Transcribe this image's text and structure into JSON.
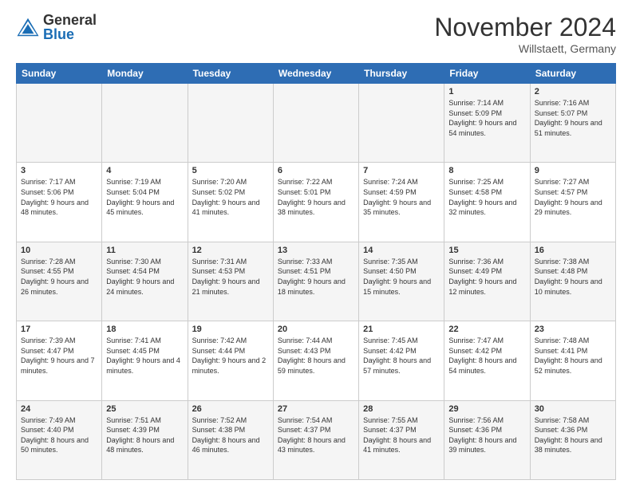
{
  "logo": {
    "general": "General",
    "blue": "Blue"
  },
  "header": {
    "month": "November 2024",
    "location": "Willstaett, Germany"
  },
  "weekdays": [
    "Sunday",
    "Monday",
    "Tuesday",
    "Wednesday",
    "Thursday",
    "Friday",
    "Saturday"
  ],
  "weeks": [
    [
      {
        "day": "",
        "info": ""
      },
      {
        "day": "",
        "info": ""
      },
      {
        "day": "",
        "info": ""
      },
      {
        "day": "",
        "info": ""
      },
      {
        "day": "",
        "info": ""
      },
      {
        "day": "1",
        "info": "Sunrise: 7:14 AM\nSunset: 5:09 PM\nDaylight: 9 hours and 54 minutes."
      },
      {
        "day": "2",
        "info": "Sunrise: 7:16 AM\nSunset: 5:07 PM\nDaylight: 9 hours and 51 minutes."
      }
    ],
    [
      {
        "day": "3",
        "info": "Sunrise: 7:17 AM\nSunset: 5:06 PM\nDaylight: 9 hours and 48 minutes."
      },
      {
        "day": "4",
        "info": "Sunrise: 7:19 AM\nSunset: 5:04 PM\nDaylight: 9 hours and 45 minutes."
      },
      {
        "day": "5",
        "info": "Sunrise: 7:20 AM\nSunset: 5:02 PM\nDaylight: 9 hours and 41 minutes."
      },
      {
        "day": "6",
        "info": "Sunrise: 7:22 AM\nSunset: 5:01 PM\nDaylight: 9 hours and 38 minutes."
      },
      {
        "day": "7",
        "info": "Sunrise: 7:24 AM\nSunset: 4:59 PM\nDaylight: 9 hours and 35 minutes."
      },
      {
        "day": "8",
        "info": "Sunrise: 7:25 AM\nSunset: 4:58 PM\nDaylight: 9 hours and 32 minutes."
      },
      {
        "day": "9",
        "info": "Sunrise: 7:27 AM\nSunset: 4:57 PM\nDaylight: 9 hours and 29 minutes."
      }
    ],
    [
      {
        "day": "10",
        "info": "Sunrise: 7:28 AM\nSunset: 4:55 PM\nDaylight: 9 hours and 26 minutes."
      },
      {
        "day": "11",
        "info": "Sunrise: 7:30 AM\nSunset: 4:54 PM\nDaylight: 9 hours and 24 minutes."
      },
      {
        "day": "12",
        "info": "Sunrise: 7:31 AM\nSunset: 4:53 PM\nDaylight: 9 hours and 21 minutes."
      },
      {
        "day": "13",
        "info": "Sunrise: 7:33 AM\nSunset: 4:51 PM\nDaylight: 9 hours and 18 minutes."
      },
      {
        "day": "14",
        "info": "Sunrise: 7:35 AM\nSunset: 4:50 PM\nDaylight: 9 hours and 15 minutes."
      },
      {
        "day": "15",
        "info": "Sunrise: 7:36 AM\nSunset: 4:49 PM\nDaylight: 9 hours and 12 minutes."
      },
      {
        "day": "16",
        "info": "Sunrise: 7:38 AM\nSunset: 4:48 PM\nDaylight: 9 hours and 10 minutes."
      }
    ],
    [
      {
        "day": "17",
        "info": "Sunrise: 7:39 AM\nSunset: 4:47 PM\nDaylight: 9 hours and 7 minutes."
      },
      {
        "day": "18",
        "info": "Sunrise: 7:41 AM\nSunset: 4:45 PM\nDaylight: 9 hours and 4 minutes."
      },
      {
        "day": "19",
        "info": "Sunrise: 7:42 AM\nSunset: 4:44 PM\nDaylight: 9 hours and 2 minutes."
      },
      {
        "day": "20",
        "info": "Sunrise: 7:44 AM\nSunset: 4:43 PM\nDaylight: 8 hours and 59 minutes."
      },
      {
        "day": "21",
        "info": "Sunrise: 7:45 AM\nSunset: 4:42 PM\nDaylight: 8 hours and 57 minutes."
      },
      {
        "day": "22",
        "info": "Sunrise: 7:47 AM\nSunset: 4:42 PM\nDaylight: 8 hours and 54 minutes."
      },
      {
        "day": "23",
        "info": "Sunrise: 7:48 AM\nSunset: 4:41 PM\nDaylight: 8 hours and 52 minutes."
      }
    ],
    [
      {
        "day": "24",
        "info": "Sunrise: 7:49 AM\nSunset: 4:40 PM\nDaylight: 8 hours and 50 minutes."
      },
      {
        "day": "25",
        "info": "Sunrise: 7:51 AM\nSunset: 4:39 PM\nDaylight: 8 hours and 48 minutes."
      },
      {
        "day": "26",
        "info": "Sunrise: 7:52 AM\nSunset: 4:38 PM\nDaylight: 8 hours and 46 minutes."
      },
      {
        "day": "27",
        "info": "Sunrise: 7:54 AM\nSunset: 4:37 PM\nDaylight: 8 hours and 43 minutes."
      },
      {
        "day": "28",
        "info": "Sunrise: 7:55 AM\nSunset: 4:37 PM\nDaylight: 8 hours and 41 minutes."
      },
      {
        "day": "29",
        "info": "Sunrise: 7:56 AM\nSunset: 4:36 PM\nDaylight: 8 hours and 39 minutes."
      },
      {
        "day": "30",
        "info": "Sunrise: 7:58 AM\nSunset: 4:36 PM\nDaylight: 8 hours and 38 minutes."
      }
    ]
  ]
}
